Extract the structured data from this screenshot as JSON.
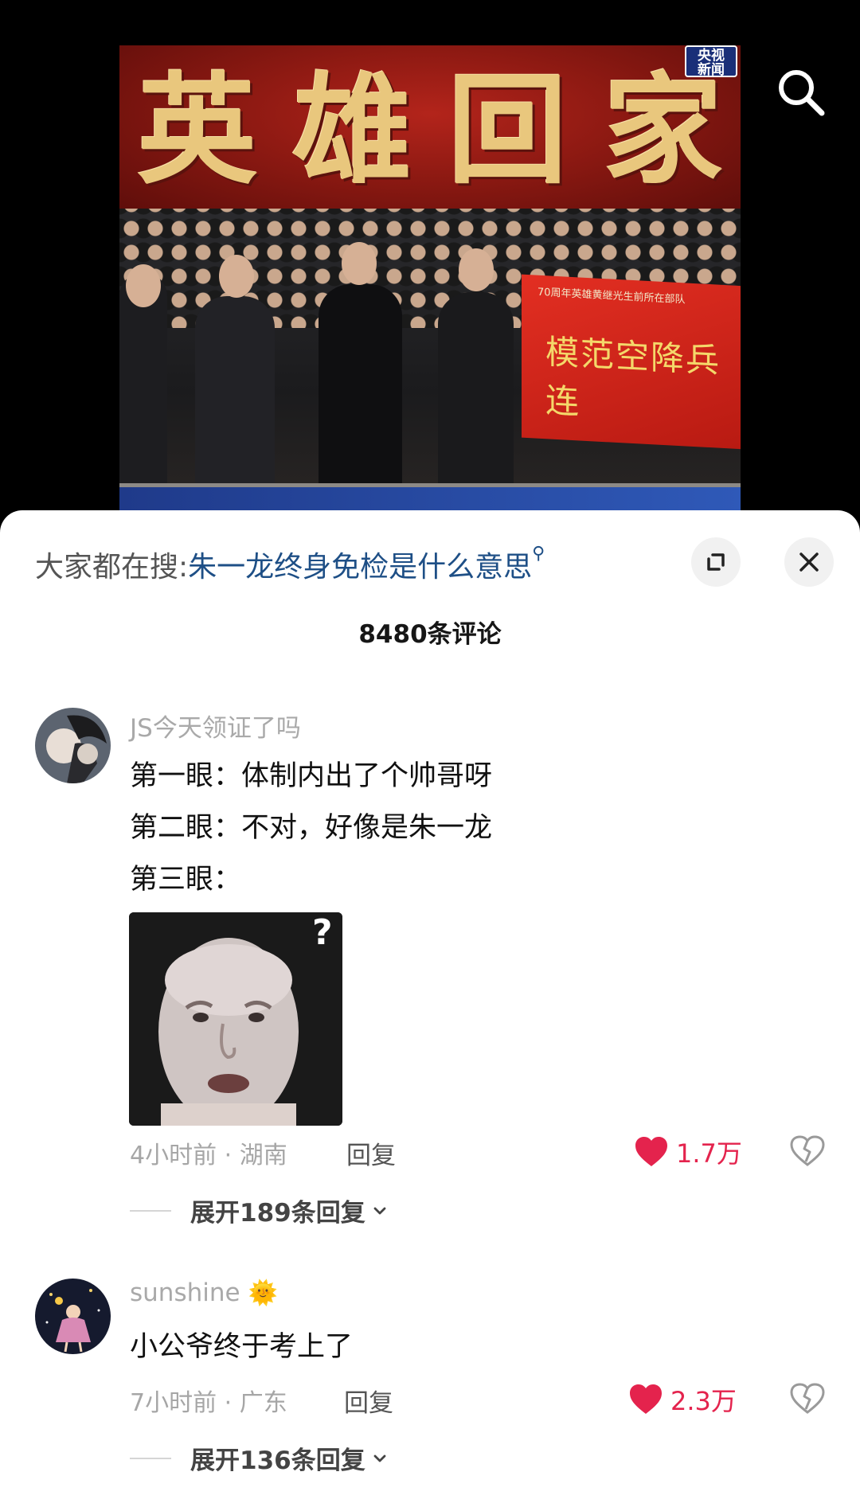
{
  "video": {
    "banner_text": [
      "英",
      "雄",
      "回",
      "家"
    ],
    "news_logo": "央视\n新闻",
    "red_banner_small": "70周年英雄黄继光生前所在部队",
    "red_banner_big": "模范空降兵连"
  },
  "header": {
    "search_prefix": "大家都在搜:",
    "search_term": "朱一龙终身免检是什么意思",
    "search_glyph": "⚲",
    "comment_count": "8480条评论"
  },
  "comments": [
    {
      "username": "JS今天领证了吗",
      "lines": [
        "第一眼：体制内出了个帅哥呀",
        "第二眼：不对，好像是朱一龙",
        "第三眼："
      ],
      "time_location": "4小时前 · 湖南",
      "reply_label": "回复",
      "likes": "1.7万",
      "expand_label": "展开189条回复"
    },
    {
      "username": "sunshine",
      "emoji": "🌞",
      "lines": [
        "小公爷终于考上了"
      ],
      "time_location": "7小时前 · 广东",
      "reply_label": "回复",
      "likes": "2.3万",
      "expand_label": "展开136条回复"
    }
  ],
  "colors": {
    "accent_blue": "#1e4f86",
    "like_red": "#e4234d",
    "muted": "#a6a6a6"
  }
}
